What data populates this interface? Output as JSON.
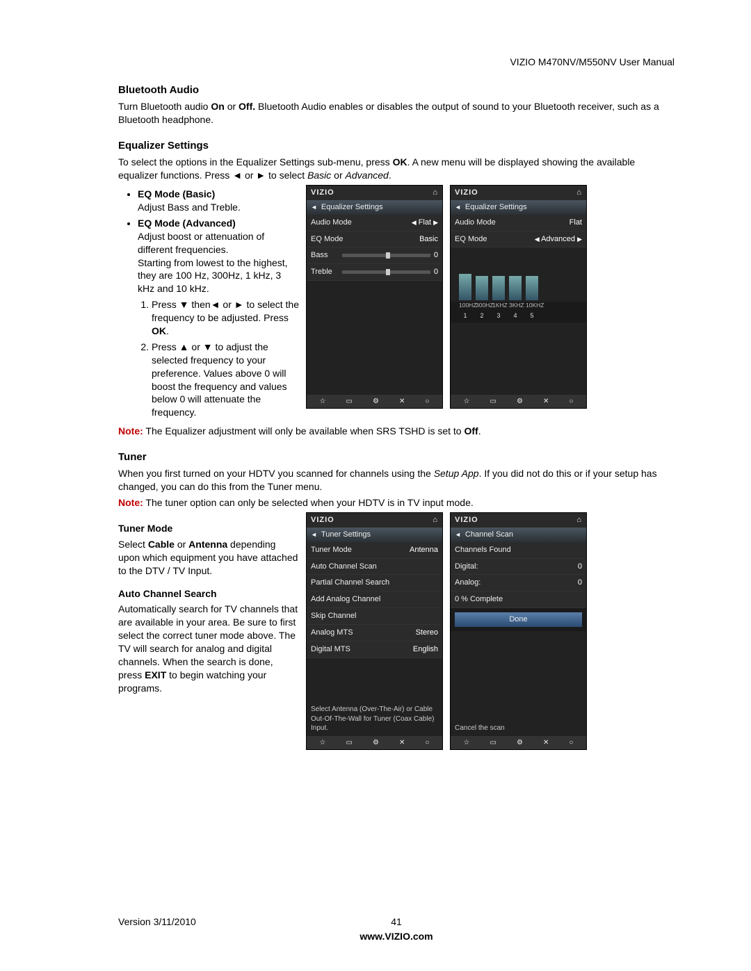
{
  "header": "VIZIO M470NV/M550NV User Manual",
  "sections": {
    "bt": {
      "title": "Bluetooth Audio",
      "p1a": "Turn Bluetooth audio ",
      "p1b": "On",
      "p1c": " or ",
      "p1d": "Off.",
      "p1e": " Bluetooth Audio enables or disables the output of sound to your Bluetooth receiver, such as a Bluetooth headphone."
    },
    "eq": {
      "title": "Equalizer Settings",
      "p1a": "To select the options in the Equalizer Settings sub-menu, press ",
      "p1b": "OK",
      "p1c": ". A new menu will be displayed showing the available equalizer functions. Press ◄ or ► to select ",
      "p1d": "Basic",
      "p1e": " or ",
      "p1f": "Advanced",
      "p1g": ".",
      "bullets": {
        "basic_title": "EQ Mode (Basic)",
        "basic_text": "Adjust Bass and Treble.",
        "adv_title": "EQ Mode (Advanced)",
        "adv_text1": "Adjust boost or attenuation of different frequencies.",
        "adv_text2": "Starting from lowest to the highest, they are 100 Hz, 300Hz, 1 kHz, 3 kHz and 10 kHz.",
        "step1a": "Press ▼ then◄ or ► to select the frequency to be adjusted. Press ",
        "step1b": "OK",
        "step1c": ".",
        "step2": "Press ▲ or ▼ to adjust the selected frequency to your preference. Values above 0 will boost the frequency and values below 0 will attenuate the frequency."
      },
      "note_label": "Note:",
      "note_a": " The Equalizer adjustment will only be available when SRS TSHD is set to ",
      "note_b": "Off",
      "note_c": "."
    },
    "tuner": {
      "title": "Tuner",
      "p1a": "When you first turned on your HDTV you scanned for channels using the ",
      "p1b": "Setup App",
      "p1c": ". If you did not do this or if your setup has changed, you can do this from the Tuner menu.",
      "note_label": "Note:",
      "note_text": " The tuner option can only be selected when your HDTV is in TV input mode.",
      "tm_title": "Tuner Mode",
      "tm_a": "Select ",
      "tm_b": "Cable",
      "tm_c": " or ",
      "tm_d": "Antenna",
      "tm_e": " depending upon which equipment you have attached to the DTV / TV Input.",
      "acs_title": "Auto Channel Search",
      "acs_a": "Automatically search for TV channels that are available in your area. Be sure to first select the correct tuner mode above. The TV will search for analog and digital channels. When the search is done, press ",
      "acs_b": "EXIT",
      "acs_c": " to begin watching your programs."
    }
  },
  "shots": {
    "brand": "VIZIO",
    "home_icon": "⌂",
    "back_icon": "◄",
    "eq_basic": {
      "subtitle": "Equalizer Settings",
      "row1_l": "Audio Mode",
      "row1_r": "Flat",
      "row2_l": "EQ Mode",
      "row2_r": "Basic",
      "row3_l": "Bass",
      "row3_r": "0",
      "row4_l": "Treble",
      "row4_r": "0"
    },
    "eq_adv": {
      "subtitle": "Equalizer Settings",
      "row1_l": "Audio Mode",
      "row1_r": "Flat",
      "row2_l": "EQ Mode",
      "row2_r": "Advanced",
      "freq_labels": [
        "100HZ",
        "300HZ",
        "1KHZ",
        "3KHZ",
        "10KHZ"
      ],
      "freq_nums": [
        "1",
        "2",
        "3",
        "4",
        "5"
      ]
    },
    "tuner_settings": {
      "subtitle": "Tuner Settings",
      "r1_l": "Tuner Mode",
      "r1_r": "Antenna",
      "r2": "Auto Channel Scan",
      "r3": "Partial Channel Search",
      "r4": "Add Analog Channel",
      "r5": "Skip Channel",
      "r6_l": "Analog MTS",
      "r6_r": "Stereo",
      "r7_l": "Digital MTS",
      "r7_r": "English",
      "hint": "Select Antenna (Over-The-Air) or Cable Out-Of-The-Wall for Tuner (Coax Cable) Input."
    },
    "channel_scan": {
      "subtitle": "Channel Scan",
      "r1": "Channels Found",
      "r2_l": "Digital:",
      "r2_r": "0",
      "r3_l": "Analog:",
      "r3_r": "0",
      "r4": "0 % Complete",
      "done": "Done",
      "hint": "Cancel the scan"
    },
    "footer_icons": [
      "☆",
      "▭",
      "⚙",
      "✕",
      "○"
    ]
  },
  "footer": {
    "version": "Version 3/11/2010",
    "page": "41",
    "url": "www.VIZIO.com"
  }
}
